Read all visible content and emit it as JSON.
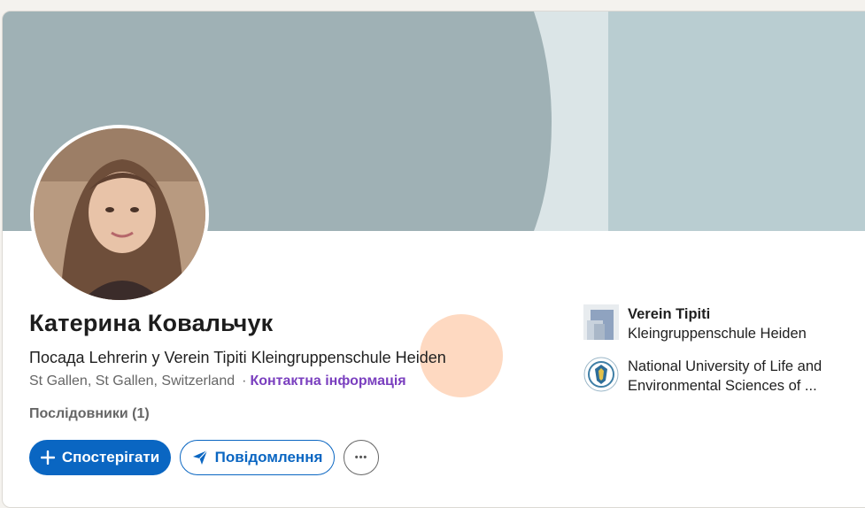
{
  "profile": {
    "name": "Катерина Ковальчук",
    "headline": "Посада Lehrerin у Verein Tipiti Kleingruppenschule Heiden",
    "location": "St Gallen, St Gallen, Switzerland",
    "separator": "·",
    "contact_info_label": "Контактна інформація",
    "followers_label": "Послідовники (1)"
  },
  "actions": {
    "follow_label": "Спостерігати",
    "message_label": "Повідомлення",
    "more_label": "•••"
  },
  "organizations": [
    {
      "line1": "Verein Tipiti",
      "line2": "Kleingruppenschule Heiden",
      "icon": "company-logo-icon"
    },
    {
      "line1": "National University of Life and",
      "line2": "Environmental Sciences of ...",
      "icon": "university-crest-icon"
    }
  ],
  "colors": {
    "primary_blue": "#0a66c2",
    "contact_link": "#7a3fbf",
    "banner_dark": "#9fb1b5",
    "banner_light": "#dbe5e7",
    "banner_right": "#b9cdd1"
  }
}
